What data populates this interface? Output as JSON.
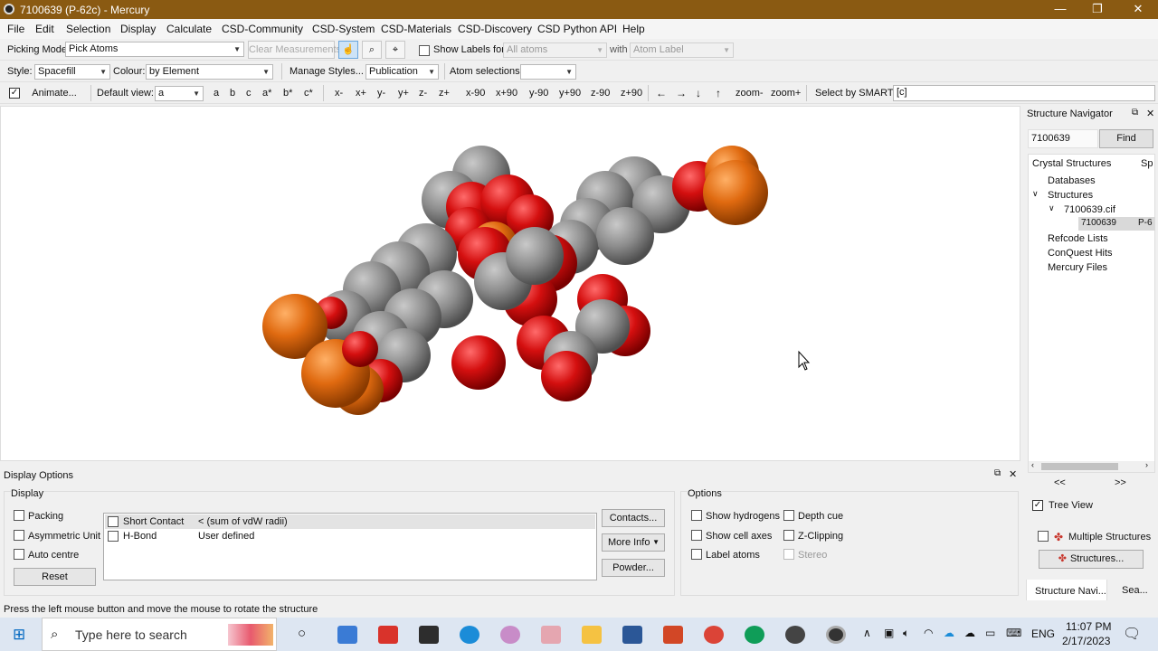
{
  "window": {
    "title": "7100639 (P-62c) - Mercury",
    "min": "—",
    "max": "❐",
    "close": "✕"
  },
  "menu": [
    "File",
    "Edit",
    "Selection",
    "Display",
    "Calculate",
    "CSD-Community",
    "CSD-System",
    "CSD-Materials",
    "CSD-Discovery",
    "CSD Python API",
    "Help"
  ],
  "toolbar1": {
    "picking_mode_label": "Picking Mode:",
    "picking_mode_value": "Pick Atoms",
    "clear_measurements": "Clear Measurements",
    "show_labels_for": "Show Labels for",
    "labels_target": "All atoms",
    "with": "with",
    "label_type": "Atom Label"
  },
  "toolbar2": {
    "style_label": "Style:",
    "style_value": "Spacefill",
    "colour_label": "Colour:",
    "colour_value": "by Element",
    "manage_styles": "Manage Styles...",
    "preset_value": "Publication",
    "atom_selections_label": "Atom selections:",
    "atom_selections_value": ""
  },
  "toolbar3": {
    "animate": "Animate...",
    "default_view_label": "Default view:",
    "default_view_value": "a",
    "axes": [
      "a",
      "b",
      "c",
      "a*",
      "b*",
      "c*"
    ],
    "rotations": [
      "x-",
      "x+",
      "y-",
      "y+",
      "z-",
      "z+",
      "x-90",
      "x+90",
      "y-90",
      "y+90",
      "z-90",
      "z+90"
    ],
    "arrows": [
      "←",
      "→",
      "↓",
      "↑"
    ],
    "zoom_minus": "zoom-",
    "zoom_plus": "zoom+",
    "smarts_label": "Select by SMARTS:",
    "smarts_value": "[c]"
  },
  "navigator": {
    "title": "Structure Navigator",
    "search_value": "7100639",
    "find": "Find",
    "col1": "Crystal Structures",
    "col2": "Sp",
    "items": {
      "databases": "Databases",
      "structures": "Structures",
      "cif": "7100639.cif",
      "entry": "7100639",
      "entry_sg": "P-6",
      "refcode_lists": "Refcode Lists",
      "conquest_hits": "ConQuest Hits",
      "mercury_files": "Mercury Files"
    },
    "prev": "<<",
    "next": ">>",
    "tree_view": "Tree View",
    "multiple_structures": "Multiple Structures",
    "structures_btn": "Structures...",
    "tab1": "Structure Navi...",
    "tab2": "Sea..."
  },
  "display_options": {
    "title": "Display Options",
    "display_group": "Display",
    "packing": "Packing",
    "asym_unit": "Asymmetric Unit",
    "auto_centre": "Auto centre",
    "reset": "Reset",
    "contacts": [
      {
        "name": "Short Contact",
        "def": "< (sum of vdW radii)"
      },
      {
        "name": "H-Bond",
        "def": "User defined"
      }
    ],
    "contacts_btn": "Contacts...",
    "more_info": "More Info",
    "powder": "Powder...",
    "options_group": "Options",
    "show_hydrogens": "Show hydrogens",
    "depth_cue": "Depth cue",
    "show_cell_axes": "Show cell axes",
    "z_clipping": "Z-Clipping",
    "label_atoms": "Label atoms",
    "stereo": "Stereo"
  },
  "status": "Press the left mouse button and move the mouse to rotate the structure",
  "taskbar": {
    "search_placeholder": "Type here to search",
    "lang": "ENG",
    "time": "11:07 PM",
    "date": "2/17/2023"
  },
  "colors": {
    "titlebar": "#8a5a12",
    "oxygen": "#d40f0f",
    "carbon": "#8c8c8c",
    "iron": "#e06a10"
  }
}
